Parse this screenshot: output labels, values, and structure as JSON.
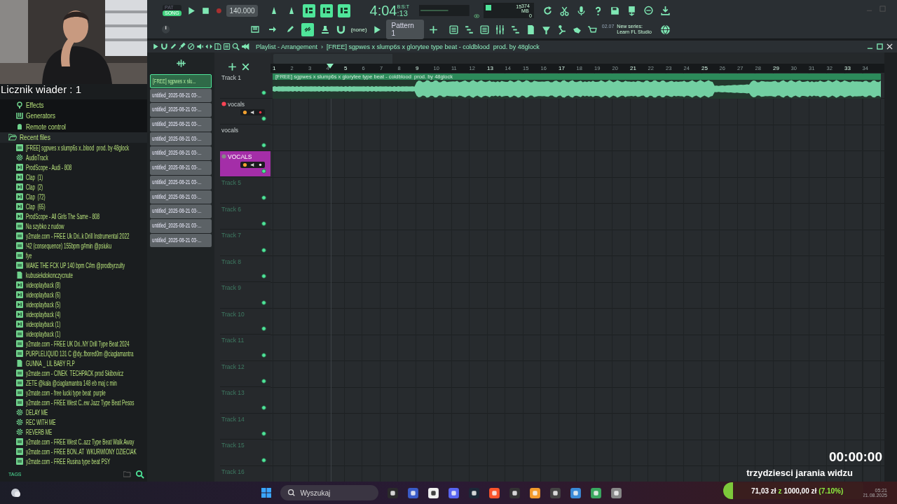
{
  "toolbar": {
    "mode": [
      {
        "label": "PAT",
        "selected": false
      },
      {
        "label": "SONG",
        "selected": true
      }
    ],
    "recording": false,
    "tempo": "140.000",
    "toggles": [
      {
        "on": false
      },
      {
        "on": false
      },
      {
        "on": true
      },
      {
        "on": true
      },
      {
        "on": true
      }
    ],
    "time": {
      "main": "4:04",
      "sub": ":13",
      "unit": "B:S:T"
    },
    "cpu": "15",
    "memory": "374 MB",
    "polyphony": "0",
    "tools": [
      {
        "on": false
      },
      {
        "on": false
      },
      {
        "on": false
      },
      {
        "on": true
      },
      {
        "on": false
      }
    ],
    "snap": "(none)",
    "pattern": "Pattern 1",
    "hint": {
      "number": "02.07",
      "text": "New series: Learn FL Studio"
    }
  },
  "overlay": {
    "counter": "Licznik wiader : 1",
    "timer": "00:00:00",
    "caption": "trzydziesci jarania widzu",
    "donation": {
      "current": "71,03 zł",
      "separator": "z",
      "goal": "1000,00 zł",
      "percent": "(7.10%)",
      "level": 0.071
    }
  },
  "browser": {
    "sections": [
      {
        "label": "Effects",
        "kind": "effects"
      },
      {
        "label": "Generators",
        "kind": "generators"
      },
      {
        "label": "Remote control",
        "kind": "remote"
      }
    ],
    "recent": {
      "label": "Recent files",
      "expanded": true,
      "items": [
        {
          "label": "[FREE] sgpwes x slump6s x..blood  prod. by 48glock",
          "kind": "mp3"
        },
        {
          "label": "AudioTrack",
          "kind": "plugin"
        },
        {
          "label": "ProdScope - Audi - 808",
          "kind": "sample"
        },
        {
          "label": "Clap  (1)",
          "kind": "sample"
        },
        {
          "label": "Clap  (2)",
          "kind": "sample"
        },
        {
          "label": "Clap  (72)",
          "kind": "sample"
        },
        {
          "label": "Clap  (65)",
          "kind": "sample"
        },
        {
          "label": "ProdScope - All Girls The Same - 808",
          "kind": "sample"
        },
        {
          "label": "Na szybko z nudow",
          "kind": "mp3"
        },
        {
          "label": "y2mate.com - FREE Uk Dri..k Drill Instrumental 2022",
          "kind": "mp3"
        },
        {
          "label": "!42 (consequence) 155bpm g#min @psiuku",
          "kind": "mp3"
        },
        {
          "label": "fye",
          "kind": "mp3"
        },
        {
          "label": "WAKE THE FCK UP 140 bpm C#m @prodbyrzulty",
          "kind": "mp3"
        },
        {
          "label": "kubusiekdokonczycnute",
          "kind": "project"
        },
        {
          "label": "videoplayback (8)",
          "kind": "sample"
        },
        {
          "label": "videoplayback (6)",
          "kind": "sample"
        },
        {
          "label": "videoplayback (5)",
          "kind": "sample"
        },
        {
          "label": "videoplayback (4)",
          "kind": "sample"
        },
        {
          "label": "videoplayback (1)",
          "kind": "sample"
        },
        {
          "label": "videoplayback (1)",
          "kind": "mp3"
        },
        {
          "label": "y2mate.com - FREE UK Dri..NY Drill Type Beat 2024",
          "kind": "mp3"
        },
        {
          "label": "PURPLELIQUID 131 C @dy..fbored0m @ciaglamantra",
          "kind": "mp3"
        },
        {
          "label": "GUNNA _ LIL BABY FLP",
          "kind": "project"
        },
        {
          "label": "y2mate.com - CINEK  TECHPACK prod Skibovicz",
          "kind": "mp3"
        },
        {
          "label": "ZETE @kala @ciaglamantra 148 eb maj c min",
          "kind": "mp3"
        },
        {
          "label": "y2mate.com - free lucki type beat  purple",
          "kind": "mp3"
        },
        {
          "label": "y2mate.com - FREE West C..ew Jazz Type Beat Pesos",
          "kind": "mp3"
        },
        {
          "label": "DELAY ME",
          "kind": "plugin"
        },
        {
          "label": "REC WITH ME",
          "kind": "plugin"
        },
        {
          "label": "REVERB ME",
          "kind": "plugin"
        },
        {
          "label": "y2mate.com - FREE West C..azz Type Beat Walk Away",
          "kind": "mp3"
        },
        {
          "label": "y2mate.com - FREE BON..AT  WKURWIONY DZIECIAK",
          "kind": "mp3"
        },
        {
          "label": "y2mate.com - FREE Rusina type beat PSY",
          "kind": "mp3"
        }
      ]
    },
    "tags_label": "TAGS"
  },
  "playlist": {
    "title": "Playlist - Arrangement",
    "separator": "›",
    "song": "[FREE] sgpwes x slump6s x glorytee type beat - coldblood  prod. by 48glock",
    "patterns": [
      {
        "label": "[FREE] sgpwes x slu...",
        "selected": true
      },
      {
        "label": "untitled_2025-08-21 03-...",
        "selected": false
      },
      {
        "label": "untitled_2025-08-21 03-...",
        "selected": false
      },
      {
        "label": "untitled_2025-08-21 03-...",
        "selected": false
      },
      {
        "label": "untitled_2025-08-21 03-...",
        "selected": false
      },
      {
        "label": "untitled_2025-08-21 03-...",
        "selected": false
      },
      {
        "label": "untitled_2025-08-21 03-...",
        "selected": false
      },
      {
        "label": "untitled_2025-08-21 03-...",
        "selected": false
      },
      {
        "label": "untitled_2025-08-21 03-...",
        "selected": false
      },
      {
        "label": "untitled_2025-08-21 03-...",
        "selected": false
      },
      {
        "label": "untitled_2025-08-21 03-...",
        "selected": false
      },
      {
        "label": "untitled_2025-08-21 03-...",
        "selected": false
      }
    ],
    "bars": [
      "1",
      "2",
      "3",
      "4",
      "5",
      "6",
      "7",
      "8",
      "9",
      "10",
      "11",
      "12",
      "13",
      "14",
      "15",
      "16",
      "17",
      "18",
      "19",
      "20",
      "21",
      "22",
      "23",
      "24",
      "25",
      "26",
      "27",
      "28",
      "29",
      "30",
      "31",
      "32",
      "33",
      "34"
    ],
    "clip": {
      "label": "[FREE] sgpwes x slump6s x glorytee type beat - coldblood  prod. by 48glock"
    },
    "tracks": [
      {
        "name": "Track 1",
        "used": true,
        "controls": false
      },
      {
        "name": "vocals",
        "used": true,
        "controls": true,
        "armed": true
      },
      {
        "name": "vocals",
        "used": true,
        "controls": false
      },
      {
        "name": "VOCALS",
        "used": true,
        "controls": true,
        "armed": false,
        "color": "#a42ea8"
      },
      {
        "name": "Track 5",
        "used": false,
        "controls": false
      },
      {
        "name": "Track 6",
        "used": false,
        "controls": false
      },
      {
        "name": "Track 7",
        "used": false,
        "controls": false
      },
      {
        "name": "Track 8",
        "used": false,
        "controls": false
      },
      {
        "name": "Track 9",
        "used": false,
        "controls": false
      },
      {
        "name": "Track 10",
        "used": false,
        "controls": false
      },
      {
        "name": "Track 11",
        "used": false,
        "controls": false
      },
      {
        "name": "Track 12",
        "used": false,
        "controls": false
      },
      {
        "name": "Track 13",
        "used": false,
        "controls": false
      },
      {
        "name": "Track 14",
        "used": false,
        "controls": false
      },
      {
        "name": "Track 15",
        "used": false,
        "controls": false
      },
      {
        "name": "Track 16",
        "used": false,
        "controls": false
      }
    ]
  },
  "taskbar": {
    "search": {
      "placeholder": "Wyszukaj"
    },
    "time": "05:21",
    "date": "21.08.2025"
  }
}
